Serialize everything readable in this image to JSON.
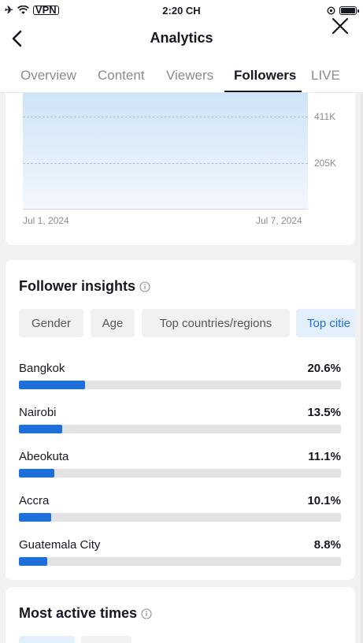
{
  "status_bar": {
    "time": "2:20 CH",
    "vpn": "VPN"
  },
  "header": {
    "title": "Analytics"
  },
  "tabs": [
    {
      "label": "Overview"
    },
    {
      "label": "Content"
    },
    {
      "label": "Viewers"
    },
    {
      "label": "Followers",
      "active": true
    },
    {
      "label": "LIVE"
    }
  ],
  "chart": {
    "y_ticks": [
      "411K",
      "205K"
    ],
    "x_ticks": [
      "Jul 1, 2024",
      "Jul 7, 2024"
    ]
  },
  "chart_data": {
    "type": "area",
    "x": [
      "Jul 1, 2024",
      "Jul 7, 2024"
    ],
    "y_ticks": [
      "205K",
      "411K"
    ],
    "series": [
      {
        "values": []
      }
    ]
  },
  "insights": {
    "title": "Follower insights",
    "filters": [
      "Gender",
      "Age",
      "Top countries/regions",
      "Top citie"
    ],
    "active_filter": "Top citie",
    "cities": [
      {
        "name": "Bangkok",
        "pct": "20.6%",
        "value": 0.206
      },
      {
        "name": "Nairobi",
        "pct": "13.5%",
        "value": 0.135
      },
      {
        "name": "Abeokuta",
        "pct": "11.1%",
        "value": 0.111
      },
      {
        "name": "Accra",
        "pct": "10.1%",
        "value": 0.101
      },
      {
        "name": "Guatemala City",
        "pct": "8.8%",
        "value": 0.088
      }
    ]
  },
  "active_times": {
    "title": "Most active times"
  },
  "colors": {
    "accent": "#1d6fdc",
    "chip_active_bg": "#e3effb",
    "track": "#e3e3e6"
  }
}
